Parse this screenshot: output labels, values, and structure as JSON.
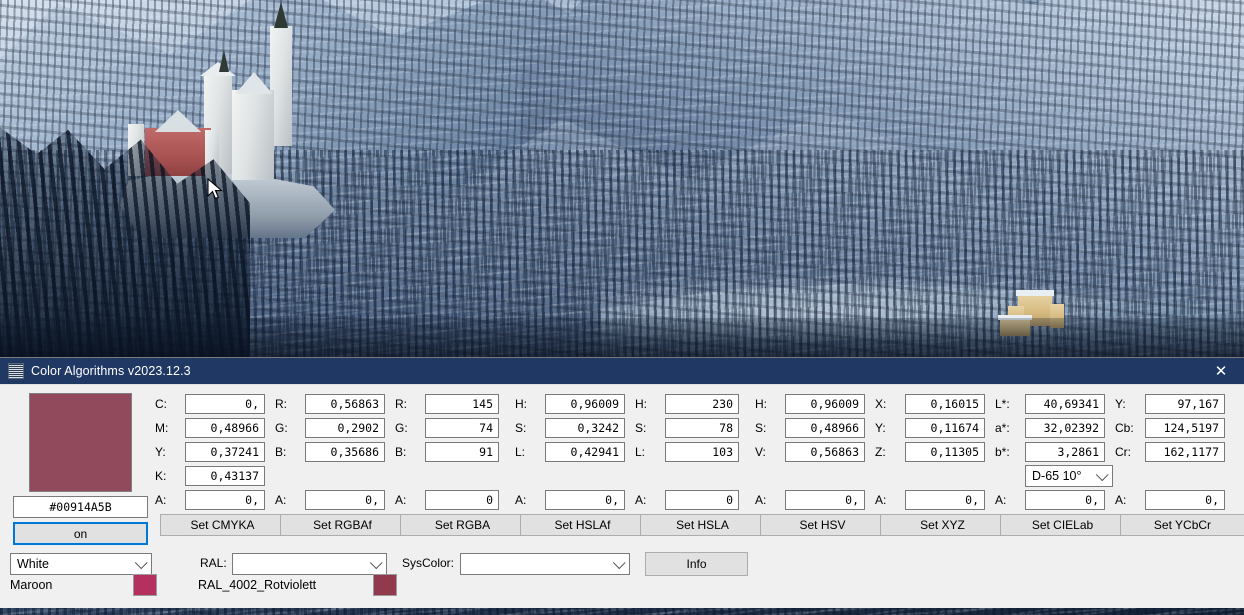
{
  "wallpaper": {
    "scene_name": "neuschwanstein-castle-winter",
    "description": "Snow covered alpine forest with Neuschwanstein castle on a ridge at left and Hohenschwangau castle beside a frozen lake at right"
  },
  "window": {
    "title": "Color Algorithms v2023.12.3",
    "icon": "app-icon",
    "close_label": "✕",
    "titlebar_color": "#1f3864"
  },
  "preview": {
    "swatch_color": "#914A5B",
    "hex_value": "#00914A5B",
    "toggle_label": "on"
  },
  "named_color": {
    "selected": "White",
    "current_name": "Maroon",
    "current_swatch": "#B3305F"
  },
  "ral": {
    "label": "RAL:",
    "selected": "",
    "current_name": "RAL_4002_Rotviolett",
    "current_swatch": "#913A4E"
  },
  "syscolor": {
    "label": "SysColor:",
    "selected": ""
  },
  "info_button": "Info",
  "columns": [
    {
      "id": "cmyka",
      "fields": [
        {
          "label": "C:",
          "value": "0,"
        },
        {
          "label": "M:",
          "value": "0,48966"
        },
        {
          "label": "Y:",
          "value": "0,37241"
        },
        {
          "label": "K:",
          "value": "0,43137"
        }
      ],
      "alpha": {
        "label": "A:",
        "value": "0,"
      },
      "button": "Set CMYKA"
    },
    {
      "id": "rgbaf",
      "fields": [
        {
          "label": "R:",
          "value": "0,56863"
        },
        {
          "label": "G:",
          "value": "0,2902"
        },
        {
          "label": "B:",
          "value": "0,35686"
        }
      ],
      "alpha": {
        "label": "A:",
        "value": "0,"
      },
      "button": "Set RGBAf"
    },
    {
      "id": "rgba",
      "fields": [
        {
          "label": "R:",
          "value": "145"
        },
        {
          "label": "G:",
          "value": "74"
        },
        {
          "label": "B:",
          "value": "91"
        }
      ],
      "alpha": {
        "label": "A:",
        "value": "0"
      },
      "button": "Set RGBA"
    },
    {
      "id": "hslaf",
      "fields": [
        {
          "label": "H:",
          "value": "0,96009"
        },
        {
          "label": "S:",
          "value": "0,3242"
        },
        {
          "label": "L:",
          "value": "0,42941"
        }
      ],
      "alpha": {
        "label": "A:",
        "value": "0,"
      },
      "button": "Set  HSLAf"
    },
    {
      "id": "hsla",
      "fields": [
        {
          "label": "H:",
          "value": "230"
        },
        {
          "label": "S:",
          "value": "78"
        },
        {
          "label": "L:",
          "value": "103"
        }
      ],
      "alpha": {
        "label": "A:",
        "value": "0"
      },
      "button": "Set  HSLA"
    },
    {
      "id": "hsv",
      "fields": [
        {
          "label": "H:",
          "value": "0,96009"
        },
        {
          "label": "S:",
          "value": "0,48966"
        },
        {
          "label": "V:",
          "value": "0,56863"
        }
      ],
      "alpha": {
        "label": "A:",
        "value": "0,"
      },
      "button": "Set  HSV"
    },
    {
      "id": "xyz",
      "fields": [
        {
          "label": "X:",
          "value": "0,16015"
        },
        {
          "label": "Y:",
          "value": "0,11674"
        },
        {
          "label": "Z:",
          "value": "0,11305"
        }
      ],
      "alpha": {
        "label": "A:",
        "value": "0,"
      },
      "button": "Set  XYZ"
    },
    {
      "id": "cielab",
      "fields": [
        {
          "label": "L*:",
          "value": "40,69341"
        },
        {
          "label": "a*:",
          "value": "32,02392"
        },
        {
          "label": "b*:",
          "value": "3,2861"
        }
      ],
      "illuminant": "D-65 10°",
      "alpha": {
        "label": "A:",
        "value": "0,"
      },
      "button": "Set  CIELab"
    },
    {
      "id": "ycbcr",
      "fields": [
        {
          "label": "Y:",
          "value": "97,167"
        },
        {
          "label": "Cb:",
          "value": "124,5197"
        },
        {
          "label": "Cr:",
          "value": "162,1177"
        }
      ],
      "alpha": {
        "label": "A:",
        "value": "0,"
      },
      "button": "Set  YCbCr"
    }
  ]
}
